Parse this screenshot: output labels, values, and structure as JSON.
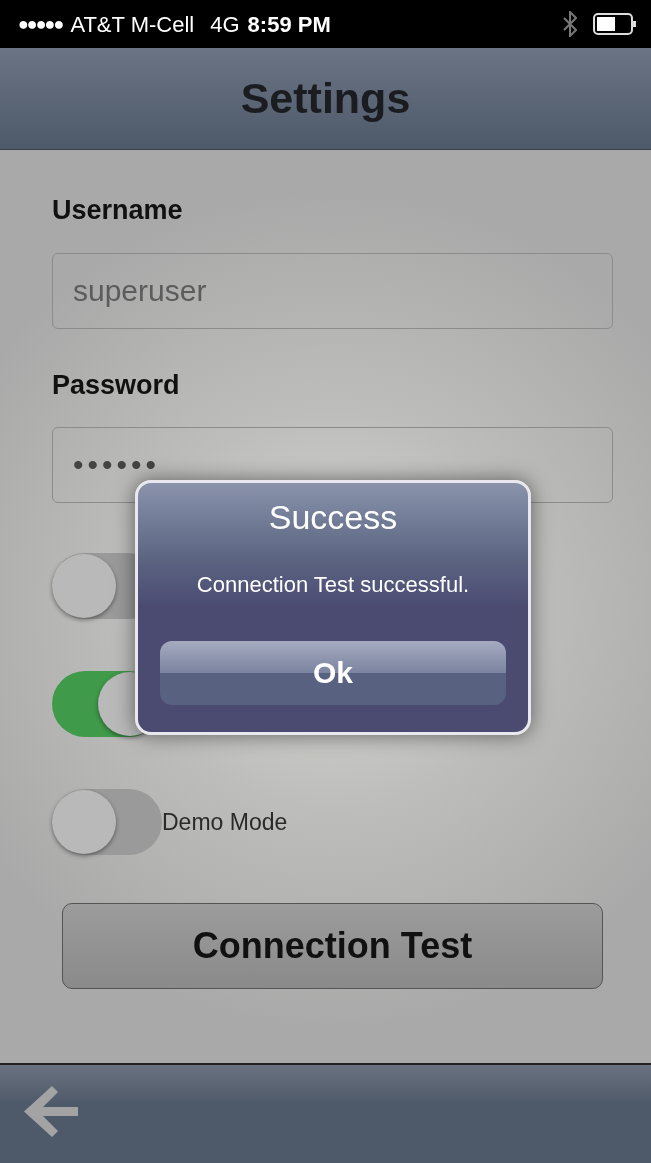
{
  "status_bar": {
    "signal_dots": "●●●●●",
    "carrier": "AT&T M-Cell",
    "network": "4G",
    "time": "8:59 PM"
  },
  "header": {
    "title": "Settings"
  },
  "form": {
    "fields": [
      {
        "label": "Username",
        "value": "superuser",
        "kind": "text"
      },
      {
        "label": "Password",
        "value": "••••••",
        "kind": "password"
      }
    ],
    "toggles": [
      {
        "on": false
      },
      {
        "on": true
      },
      {
        "label": "Demo Mode",
        "on": false
      }
    ],
    "button": "Connection Test"
  },
  "dialog": {
    "title": "Success",
    "message": "Connection Test successful.",
    "button": "Ok"
  }
}
